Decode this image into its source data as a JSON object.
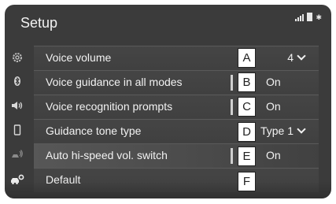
{
  "header": {
    "title": "Setup"
  },
  "status_icons": [
    "signal-icon",
    "battery-icon",
    "bluetooth-icon"
  ],
  "sidebar": [
    "gear-icon",
    "bluetooth-icon",
    "speaker-icon",
    "phone-icon",
    "car-sound-icon",
    "car-settings-icon"
  ],
  "rows": [
    {
      "label": "Voice volume",
      "value": "4",
      "callout": "A"
    },
    {
      "label": "Voice guidance in all modes",
      "value": "On",
      "callout": "B"
    },
    {
      "label": "Voice recognition prompts",
      "value": "On",
      "callout": "C"
    },
    {
      "label": "Guidance tone type",
      "value": "Type 1",
      "callout": "D"
    },
    {
      "label": "Auto hi-speed vol. switch",
      "value": "On",
      "callout": "E"
    },
    {
      "label": "Default",
      "value": "",
      "callout": "F"
    }
  ],
  "colors": {
    "screen_bg": "#3b3b3b",
    "text": "#f2f2f2",
    "callout_bg": "#ffffff"
  }
}
